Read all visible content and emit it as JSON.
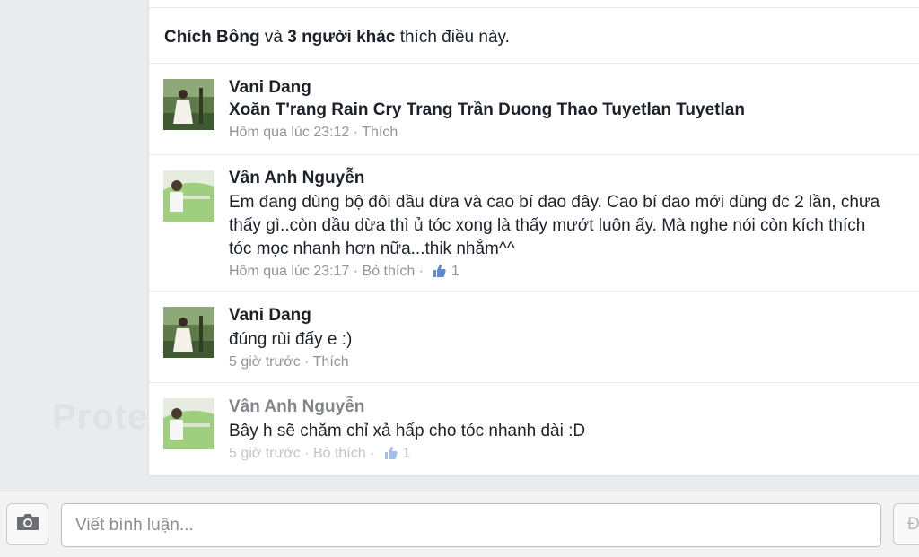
{
  "likes_summary": {
    "name": "Chích Bông",
    "conj": " và ",
    "others": "3 người khác",
    "suffix": " thích điều này."
  },
  "comments": [
    {
      "author": "Vani Dang",
      "text": "Xoăn T'rang Rain Cry Trang Trần Duong Thao Tuyetlan Tuyetlan",
      "time": "Hôm qua lúc 23:12",
      "action": "Thích"
    },
    {
      "author": "Vân Anh Nguyễn",
      "text": "Em đang dùng bộ đôi dầu dừa và cao bí đao đây. Cao bí đao mới dùng đc 2 lần, chưa thấy gì..còn dầu dừa thì ủ tóc xong là thấy mướt luôn ấy. Mà nghe nói còn kích thích tóc mọc nhanh hơn nữa...thik nhắm^^",
      "time": "Hôm qua lúc 23:17",
      "action": "Bỏ thích",
      "likes": "1"
    },
    {
      "author": "Vani Dang",
      "text": "đúng rùi đấy e :)",
      "time": "5 giờ trước",
      "action": "Thích"
    },
    {
      "author": "Vân Anh Nguyễn",
      "text": "Bây h sẽ chăm chỉ xả hấp cho tóc nhanh dài :D",
      "time": "5 giờ trước",
      "action": "Bỏ thích",
      "likes": "1"
    }
  ],
  "meta_separator": " · ",
  "composer": {
    "placeholder": "Viết bình luận...",
    "post_label": "Đăng"
  },
  "watermark": "Protect"
}
